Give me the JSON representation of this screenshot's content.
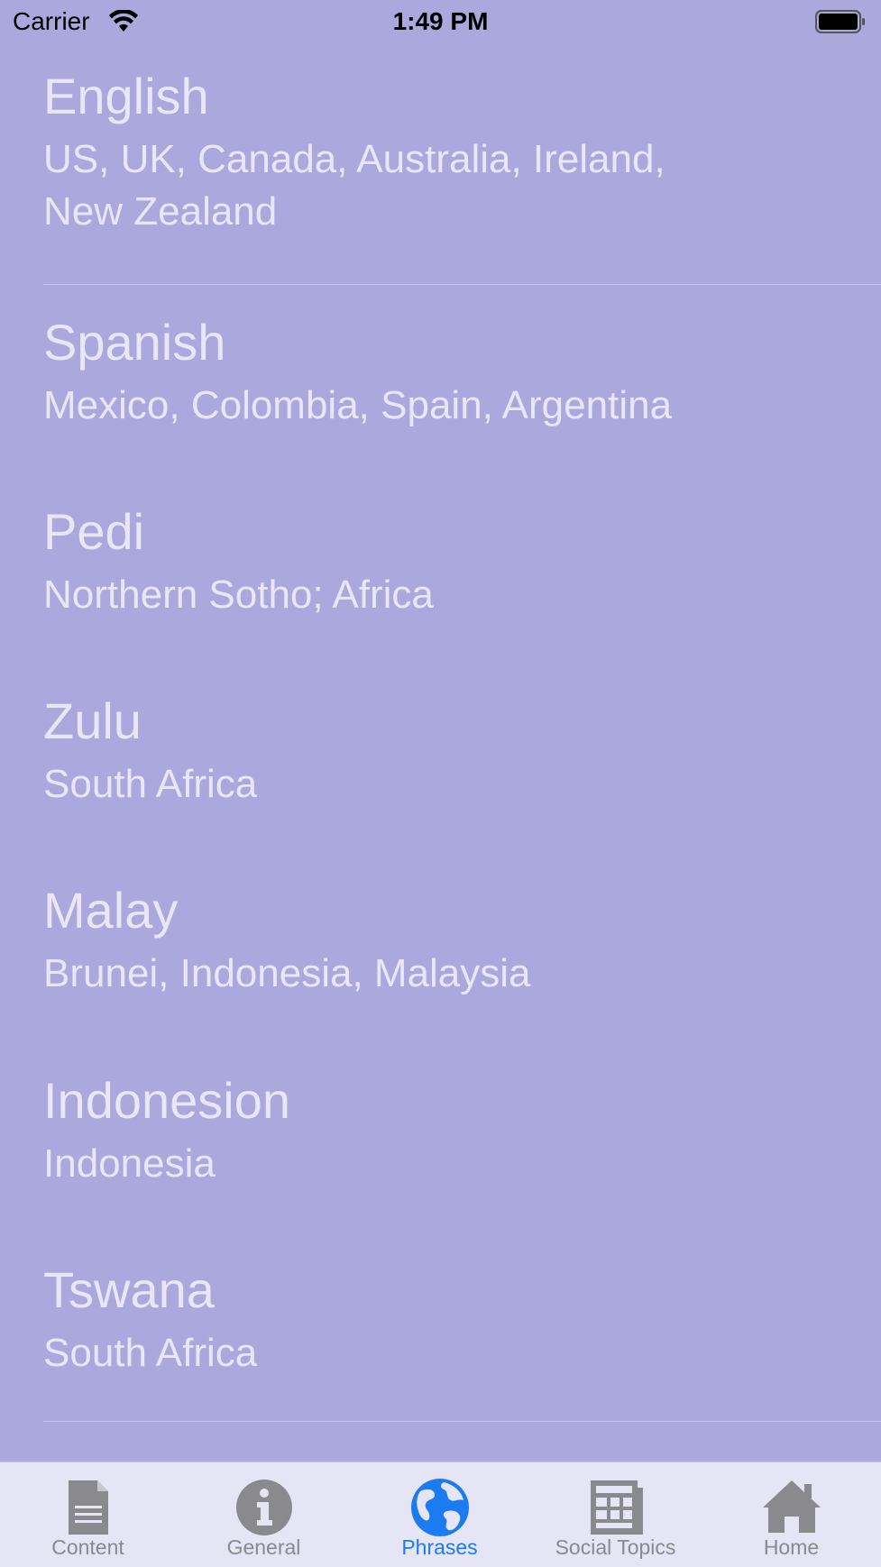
{
  "status_bar": {
    "carrier": "Carrier",
    "time": "1:49 PM",
    "wifi_icon": "wifi-icon",
    "battery_icon": "battery-icon"
  },
  "languages": [
    {
      "name": "English",
      "regions": "US, UK, Canada, Australia, Ireland, New Zealand"
    },
    {
      "name": "Spanish",
      "regions": "Mexico, Colombia, Spain, Argentina"
    },
    {
      "name": "Pedi",
      "regions": "Northern Sotho; Africa"
    },
    {
      "name": "Zulu",
      "regions": "South Africa"
    },
    {
      "name": "Malay",
      "regions": "Brunei, Indonesia, Malaysia"
    },
    {
      "name": "Indonesion",
      "regions": "Indonesia"
    },
    {
      "name": "Tswana",
      "regions": "South Africa"
    }
  ],
  "tab_bar": {
    "tabs": [
      {
        "label": "Content",
        "icon": "document-icon",
        "active": false
      },
      {
        "label": "General",
        "icon": "info-icon",
        "active": false
      },
      {
        "label": "Phrases",
        "icon": "globe-icon",
        "active": true
      },
      {
        "label": "Social Topics",
        "icon": "newspaper-icon",
        "active": false
      },
      {
        "label": "Home",
        "icon": "home-icon",
        "active": false
      }
    ]
  },
  "colors": {
    "background": "#aba8de",
    "text": "#e8e6f7",
    "tab_bar": "#e6e5f5",
    "tab_active": "#1a7cf0",
    "tab_inactive": "#8a8a8e"
  }
}
